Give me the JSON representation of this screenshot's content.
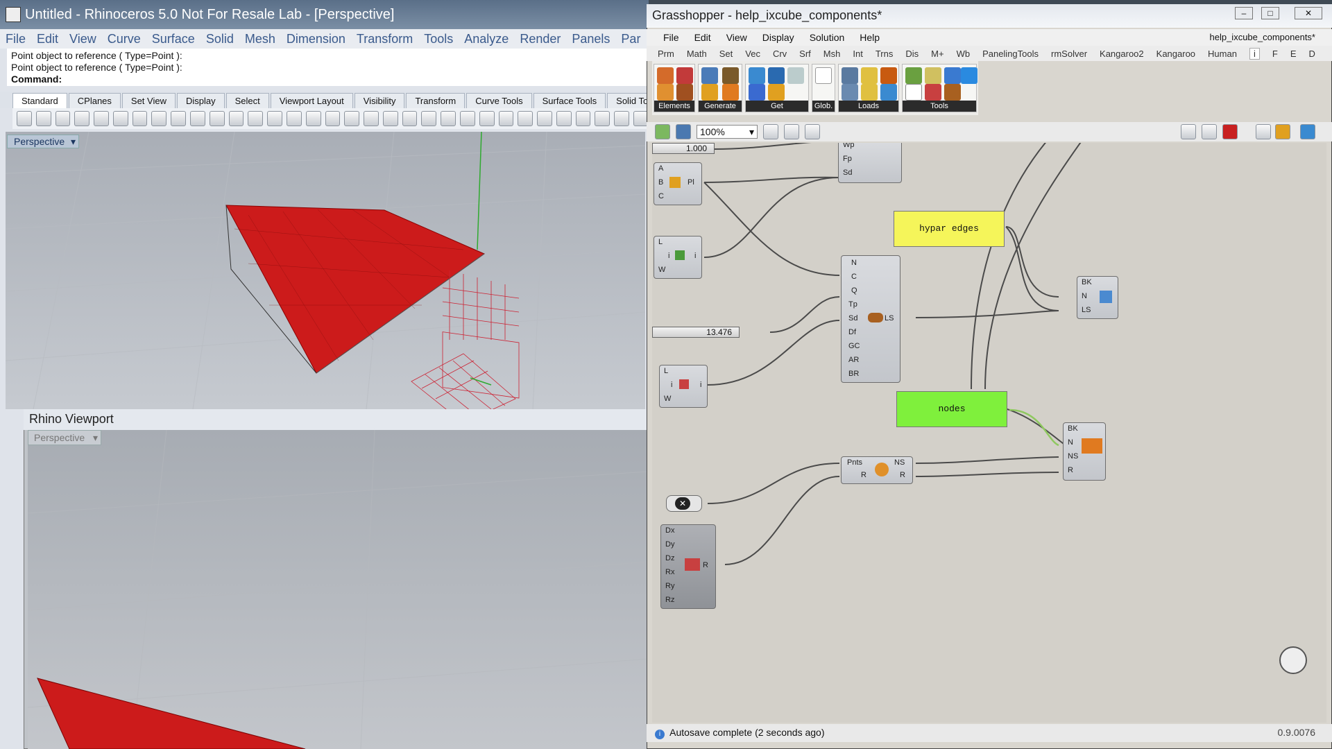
{
  "rhino": {
    "title": "Untitled - Rhinoceros 5.0 Not For Resale Lab - [Perspective]",
    "menu": [
      "File",
      "Edit",
      "View",
      "Curve",
      "Surface",
      "Solid",
      "Mesh",
      "Dimension",
      "Transform",
      "Tools",
      "Analyze",
      "Render",
      "Panels",
      "Par"
    ],
    "command_history": [
      "Point object to reference ( Type=Point ):",
      "Point object to reference ( Type=Point ):"
    ],
    "command_label": "Command:",
    "toolbar_tabs": [
      "Standard",
      "CPlanes",
      "Set View",
      "Display",
      "Select",
      "Viewport Layout",
      "Visibility",
      "Transform",
      "Curve Tools",
      "Surface Tools",
      "Solid Tools"
    ],
    "viewport_label": "Perspective",
    "viewport2_title": "Rhino Viewport",
    "viewport2_label": "Perspective"
  },
  "gh": {
    "title": "Grasshopper - help_ixcube_components*",
    "menu": [
      "File",
      "Edit",
      "View",
      "Display",
      "Solution",
      "Help"
    ],
    "doc_name": "help_ixcube_components*",
    "tabs": [
      "Prm",
      "Math",
      "Set",
      "Vec",
      "Crv",
      "Srf",
      "Msh",
      "Int",
      "Trns",
      "Dis",
      "M+",
      "Wb",
      "PanelingTools",
      "rmSolver",
      "Kangaroo2",
      "Kangaroo",
      "Human",
      "i",
      "F",
      "E",
      "D"
    ],
    "ribbon_groups": [
      "Elements",
      "Generate",
      "Get",
      "Glob.",
      "Loads",
      "Tools"
    ],
    "zoom": "100%",
    "status": "Autosave complete (2 seconds ago)",
    "version": "0.9.0076",
    "slider1": "1.000",
    "slider2": "13.476",
    "panel_edges": "hypar edges",
    "panel_nodes": "nodes",
    "comp_top": [
      "Wp",
      "Fp",
      "Sd"
    ],
    "comp_plane": [
      "A",
      "B",
      "C",
      "Pl"
    ],
    "comp_line1": [
      "L",
      "i",
      "W",
      "i"
    ],
    "comp_main": [
      "N",
      "C",
      "Q",
      "Tp",
      "Sd",
      "Df",
      "GC",
      "AR",
      "BR",
      "LS"
    ],
    "comp_line2": [
      "L",
      "i",
      "W",
      "i"
    ],
    "comp_bk1": [
      "BK",
      "N",
      "LS"
    ],
    "comp_bk2": [
      "BK",
      "N",
      "NS",
      "R"
    ],
    "comp_pnts": [
      "Pnts",
      "R",
      "NS",
      "R"
    ],
    "comp_d": [
      "Dx",
      "Dy",
      "Dz",
      "Rx",
      "Ry",
      "Rz",
      "R"
    ]
  }
}
